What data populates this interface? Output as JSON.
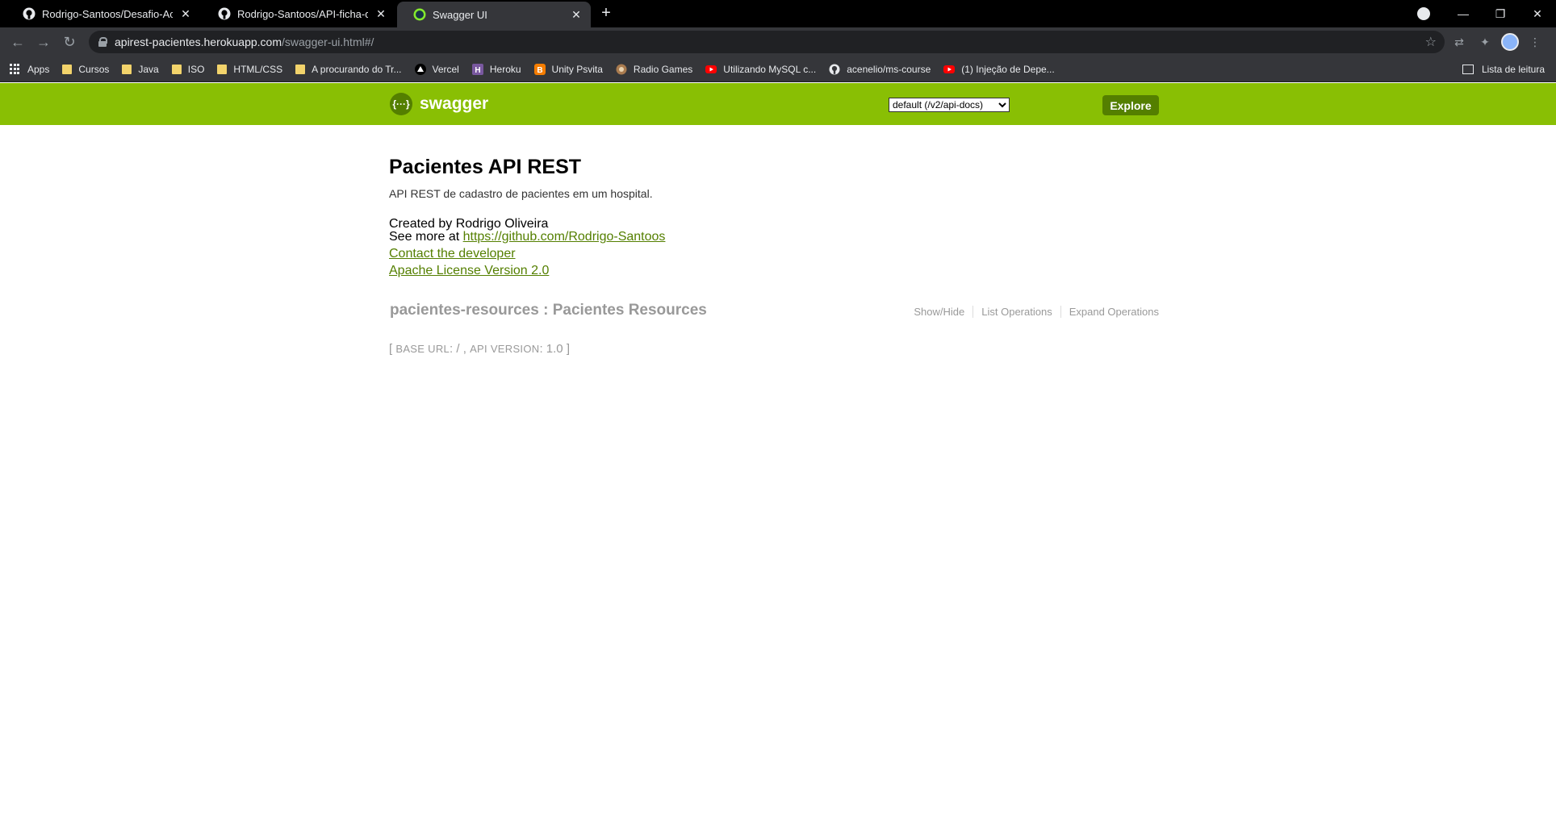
{
  "browser": {
    "tabs": [
      {
        "title": "Rodrigo-Santoos/Desafio-Academ",
        "icon": "github-icon"
      },
      {
        "title": "Rodrigo-Santoos/API-ficha-de-Pa",
        "icon": "github-icon"
      },
      {
        "title": "Swagger UI",
        "icon": "swagger-icon"
      }
    ],
    "url_host": "apirest-pacientes.herokuapp.com",
    "url_path": "/swagger-ui.html#/",
    "bookmarks": [
      {
        "label": "Apps",
        "icon": "apps-grid-icon"
      },
      {
        "label": "Cursos",
        "icon": "folder-icon"
      },
      {
        "label": "Java",
        "icon": "folder-icon"
      },
      {
        "label": "ISO",
        "icon": "folder-icon"
      },
      {
        "label": "HTML/CSS",
        "icon": "folder-icon"
      },
      {
        "label": "A procurando do Tr...",
        "icon": "folder-icon"
      },
      {
        "label": "Vercel",
        "icon": "vercel-icon"
      },
      {
        "label": "Heroku",
        "icon": "heroku-icon"
      },
      {
        "label": "Unity Psvita",
        "icon": "blogger-icon"
      },
      {
        "label": "Radio Games",
        "icon": "radio-icon"
      },
      {
        "label": "Utilizando MySQL c...",
        "icon": "youtube-icon"
      },
      {
        "label": "acenelio/ms-course",
        "icon": "github-icon"
      },
      {
        "label": "(1) Injeção de Depe...",
        "icon": "youtube-icon"
      }
    ],
    "reading_list": "Lista de leitura"
  },
  "swagger": {
    "logo_text": "swagger",
    "spec_select": "default (/v2/api-docs)",
    "explore_label": "Explore"
  },
  "api": {
    "title": "Pacientes API REST",
    "description": "API REST de cadastro de pacientes em um hospital.",
    "created_by": "Created by Rodrigo Oliveira",
    "see_more_prefix": "See more at ",
    "see_more_link": "https://github.com/Rodrigo-Santoos",
    "contact": "Contact the developer",
    "license": "Apache License Version 2.0"
  },
  "resource": {
    "title": "pacientes-resources : Pacientes Resources",
    "ops": [
      "Show/Hide",
      "List Operations",
      "Expand Operations"
    ]
  },
  "footer": {
    "open": "[ ",
    "base_url_label": "BASE URL",
    "base_url_value": ": / ",
    "sep": ", ",
    "api_version_label": "API VERSION",
    "api_version_value": ": 1.0 ",
    "close": "]"
  },
  "colors": {
    "swagger_green": "#89bf04",
    "swagger_dark_green": "#547f00",
    "link_green": "#547f00"
  }
}
